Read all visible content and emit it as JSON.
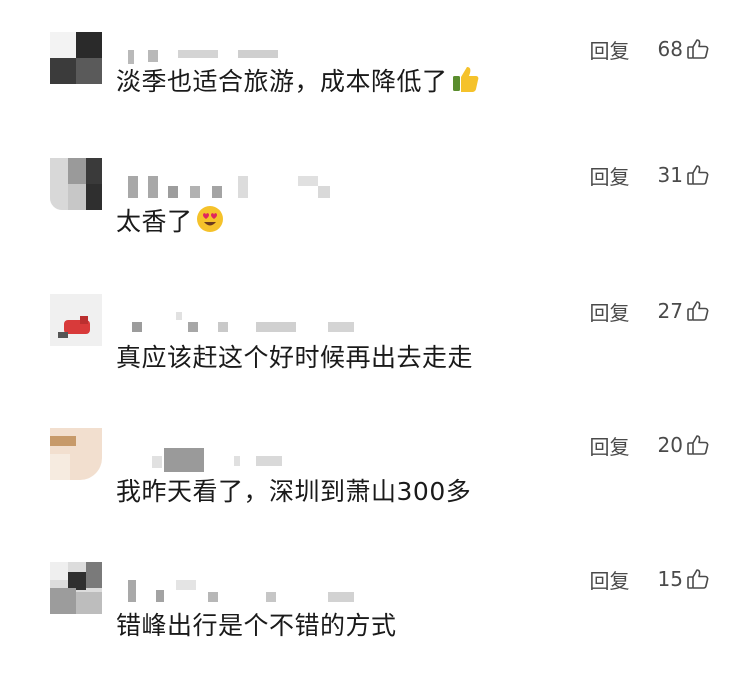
{
  "comments": [
    {
      "text": "淡季也适合旅游，成本降低了",
      "emoji": "thumbs-up-emoji",
      "reply_label": "回复",
      "likes": "68"
    },
    {
      "text": "太香了",
      "emoji": "heart-eyes-emoji",
      "reply_label": "回复",
      "likes": "31"
    },
    {
      "text": "真应该赶这个好时候再出去走走",
      "emoji": "",
      "reply_label": "回复",
      "likes": "27"
    },
    {
      "text": "我昨天看了，深圳到萧山300多",
      "emoji": "",
      "reply_label": "回复",
      "likes": "20"
    },
    {
      "text": "错峰出行是个不错的方式",
      "emoji": "",
      "reply_label": "回复",
      "likes": "15"
    }
  ],
  "colors": {
    "text": "#1a1a1a",
    "meta": "#4a4a4a",
    "emoji_yellow": "#f5c22b",
    "blur": "#b9b9b9"
  }
}
